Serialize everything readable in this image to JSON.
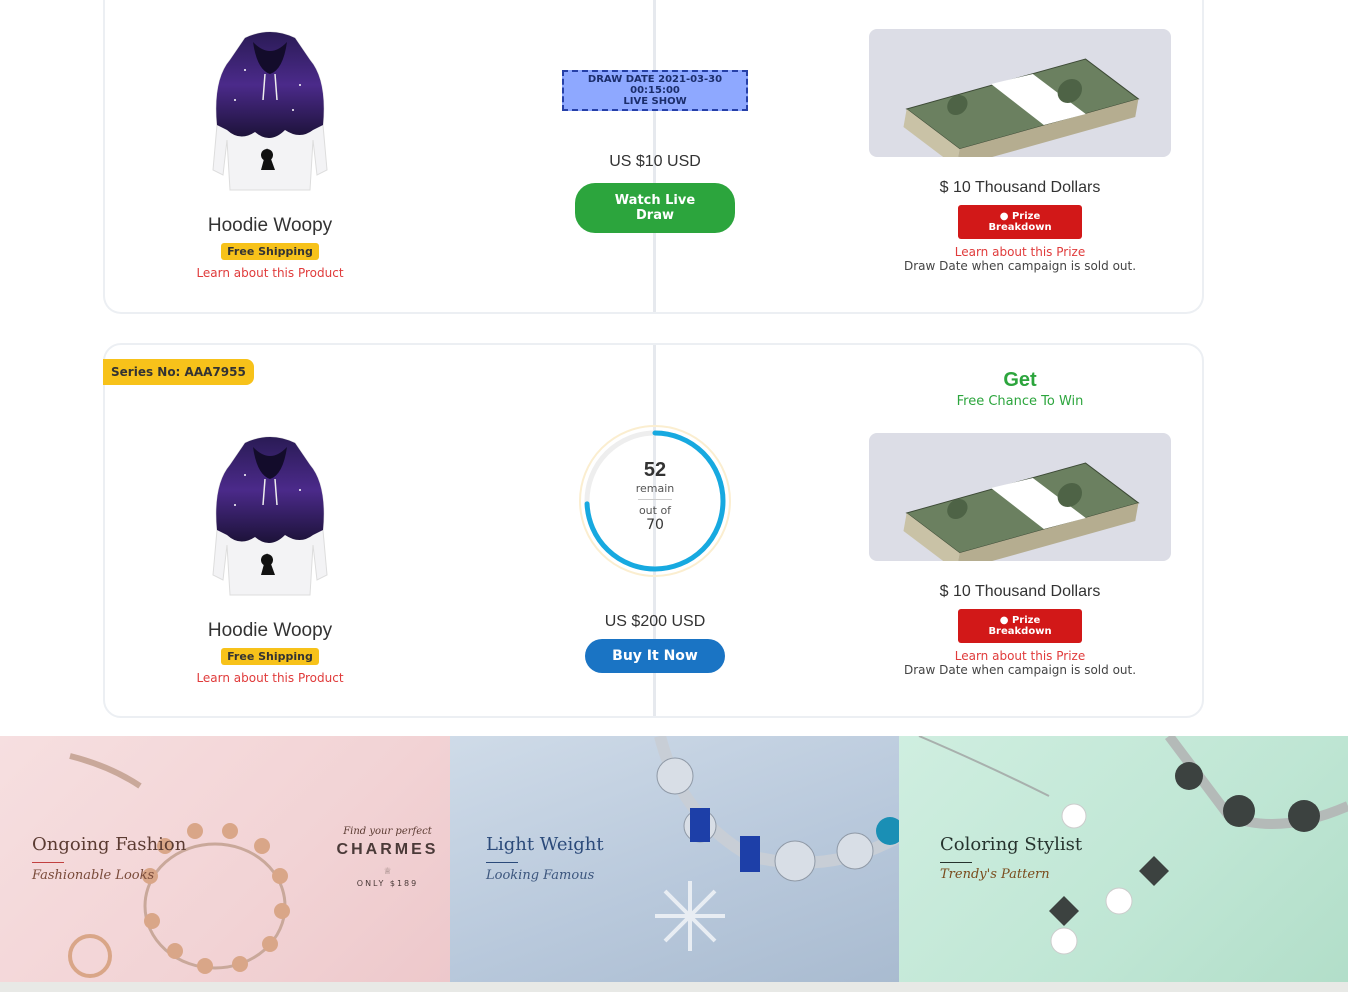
{
  "top_listing": {
    "product": {
      "name": "Hoodie Woopy",
      "shipping_badge": "Free Shipping",
      "learn_link": "Learn about this Product"
    },
    "middle": {
      "draw_date": "DRAW DATE 2021-03-30 00:15:00",
      "live_show": "LIVE SHOW",
      "price": "US $10 USD",
      "button": "Watch Live Draw"
    },
    "prize": {
      "title": "$ 10 Thousand Dollars",
      "breakdown_button": "Prize Breakdown",
      "learn_link": "Learn about this Prize",
      "draw_note": "Draw Date when campaign is sold out."
    }
  },
  "bottom_listing": {
    "series_badge": "Series No: AAA7955",
    "get_title": "Get",
    "get_sub": "Free Chance To Win",
    "product": {
      "name": "Hoodie Woopy",
      "shipping_badge": "Free Shipping",
      "learn_link": "Learn about this Product"
    },
    "counter": {
      "remain_number": "52",
      "remain_label": "remain",
      "out_of_label": "out of",
      "total": "70",
      "remaining_fraction": 0.743
    },
    "middle": {
      "price": "US $200 USD",
      "button": "Buy It Now"
    },
    "prize": {
      "title": "$ 10 Thousand Dollars",
      "breakdown_button": "Prize Breakdown",
      "learn_link": "Learn about this Prize",
      "draw_note": "Draw Date when campaign is sold out."
    }
  },
  "banners": [
    {
      "title": "Ongoing Fashion",
      "subtitle": "Fashionable Looks",
      "promo_small": "Find your perfect",
      "promo_brand": "CHARMES",
      "promo_price": "ONLY $189"
    },
    {
      "title": "Light Weight",
      "subtitle": "Looking Famous"
    },
    {
      "title": "Coloring Stylist",
      "subtitle": "Trendy's Pattern"
    }
  ],
  "colors": {
    "accent_green": "#2ca53d",
    "accent_blue": "#1a74c4",
    "accent_red": "#d21818",
    "badge_yellow": "#f7c21a",
    "link_red": "#e03b3b"
  },
  "icons": {
    "prize_button_icon": "money-bag-icon"
  }
}
